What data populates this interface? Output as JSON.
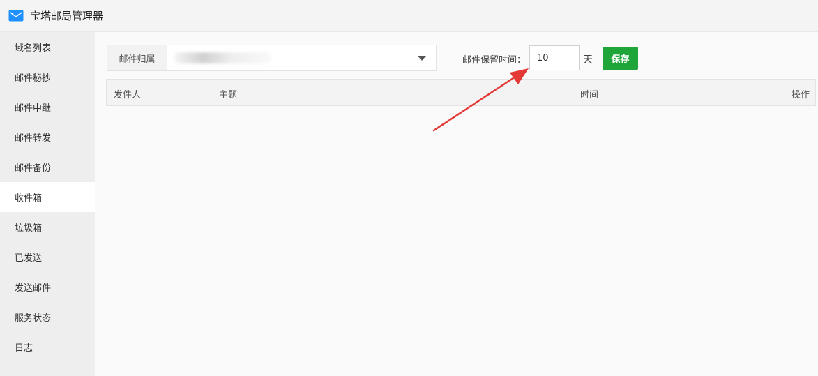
{
  "window": {
    "title": "宝塔邮局管理器",
    "icon": "mail-icon"
  },
  "sidebar": {
    "items": [
      {
        "label": "域名列表",
        "active": false
      },
      {
        "label": "邮件秘抄",
        "active": false
      },
      {
        "label": "邮件中继",
        "active": false
      },
      {
        "label": "邮件转发",
        "active": false
      },
      {
        "label": "邮件备份",
        "active": false
      },
      {
        "label": "收件箱",
        "active": true
      },
      {
        "label": "垃圾箱",
        "active": false
      },
      {
        "label": "已发送",
        "active": false
      },
      {
        "label": "发送邮件",
        "active": false
      },
      {
        "label": "服务状态",
        "active": false
      },
      {
        "label": "日志",
        "active": false
      }
    ]
  },
  "toolbar": {
    "owner_label": "邮件归属",
    "retain_label": "邮件保留时间：",
    "retain_value": "10",
    "days_label": "天",
    "save_label": "保存"
  },
  "table": {
    "headers": {
      "sender": "发件人",
      "subject": "主题",
      "time": "时间",
      "action": "操作"
    }
  },
  "colors": {
    "accent": "#20a53a",
    "annotation_arrow": "#e53935",
    "mail_icon": "#1e90ff"
  }
}
